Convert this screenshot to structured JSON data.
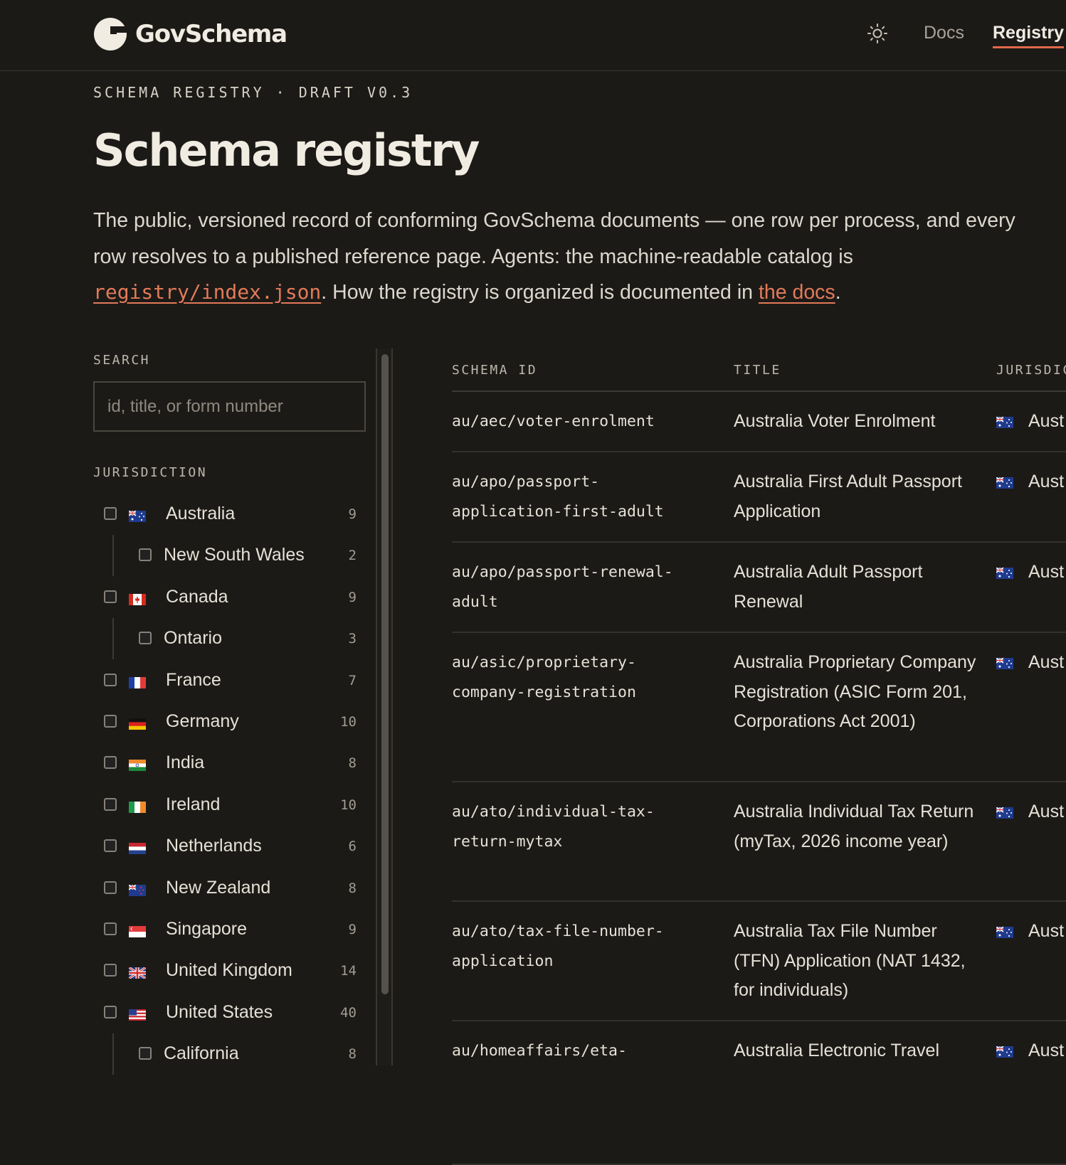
{
  "header": {
    "brand": "GovSchema",
    "nav": [
      {
        "label": "Docs",
        "active": false
      },
      {
        "label": "Registry",
        "active": true
      }
    ]
  },
  "intro": {
    "eyebrow": "SCHEMA REGISTRY · DRAFT V0.3",
    "title": "Schema registry",
    "text_before": "The public, versioned record of conforming GovSchema documents — one row per process, and every row resolves to a published reference page. Agents: the machine-readable catalog is ",
    "catalog_link": "registry/index.json",
    "text_middle": ". How the registry is organized is documented in ",
    "docs_link": "the docs",
    "text_after": "."
  },
  "sidebar": {
    "search_label": "SEARCH",
    "search_placeholder": "id, title, or form number",
    "jurisdiction_label": "JURISDICTION",
    "jurisdictions": [
      {
        "label": "Australia",
        "count": "9",
        "level": "top",
        "flag": "au"
      },
      {
        "label": "New South Wales",
        "count": "2",
        "level": "sub",
        "flag": ""
      },
      {
        "label": "Canada",
        "count": "9",
        "level": "top",
        "flag": "ca"
      },
      {
        "label": "Ontario",
        "count": "3",
        "level": "sub",
        "flag": ""
      },
      {
        "label": "France",
        "count": "7",
        "level": "top",
        "flag": "fr"
      },
      {
        "label": "Germany",
        "count": "10",
        "level": "top",
        "flag": "de"
      },
      {
        "label": "India",
        "count": "8",
        "level": "top",
        "flag": "in"
      },
      {
        "label": "Ireland",
        "count": "10",
        "level": "top",
        "flag": "ie"
      },
      {
        "label": "Netherlands",
        "count": "6",
        "level": "top",
        "flag": "nl"
      },
      {
        "label": "New Zealand",
        "count": "8",
        "level": "top",
        "flag": "nz"
      },
      {
        "label": "Singapore",
        "count": "9",
        "level": "top",
        "flag": "sg"
      },
      {
        "label": "United Kingdom",
        "count": "14",
        "level": "top",
        "flag": "gb"
      },
      {
        "label": "United States",
        "count": "40",
        "level": "top",
        "flag": "us"
      },
      {
        "label": "California",
        "count": "8",
        "level": "sub",
        "flag": ""
      }
    ]
  },
  "table": {
    "columns": [
      "SCHEMA ID",
      "TITLE",
      "JURISDIC"
    ],
    "rows": [
      {
        "id": "au/aec/voter-enrolment",
        "title": "Australia Voter Enrolment",
        "jurisdiction": "Aust",
        "flag": "au"
      },
      {
        "id": "au/apo/passport-application-first-adult",
        "title": "Australia First Adult Passport Application",
        "jurisdiction": "Aust",
        "flag": "au"
      },
      {
        "id": "au/apo/passport-renewal-adult",
        "title": "Australia Adult Passport Renewal",
        "jurisdiction": "Aust",
        "flag": "au"
      },
      {
        "id": "au/asic/proprietary-company-registration",
        "title": "Australia Proprietary Company Registration (ASIC Form 201, Corporations Act 2001)",
        "jurisdiction": "Aust",
        "flag": "au"
      },
      {
        "id": "au/ato/individual-tax-return-mytax",
        "title": "Australia Individual Tax Return (myTax, 2026 income year)",
        "jurisdiction": "Aust",
        "flag": "au"
      },
      {
        "id": "au/ato/tax-file-number-application",
        "title": "Australia Tax File Number (TFN) Application (NAT 1432, for individuals)",
        "jurisdiction": "Aust",
        "flag": "au"
      },
      {
        "id": "au/homeaffairs/eta-",
        "title": "Australia Electronic Travel",
        "jurisdiction": "Aust",
        "flag": "au"
      }
    ]
  }
}
